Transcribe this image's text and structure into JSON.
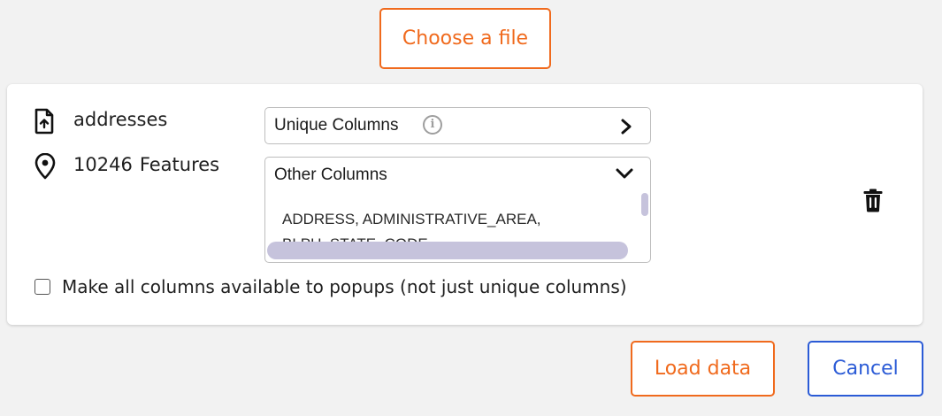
{
  "buttons": {
    "choose_file": "Choose a file",
    "load_data": "Load data",
    "cancel": "Cancel"
  },
  "file": {
    "name": "addresses",
    "feature_count": "10246",
    "feature_label": "Features",
    "icon": "file-upload-icon",
    "location_icon": "map-pin-icon"
  },
  "unique_columns": {
    "label": "Unique Columns",
    "info_icon": "info-icon",
    "state": "collapsed"
  },
  "other_columns": {
    "label": "Other Columns",
    "state": "expanded",
    "visible_text": "ADDRESS, ADMINISTRATIVE_AREA, BLPU_STATE_CODE"
  },
  "popup_option": {
    "label": "Make all columns available to popups (not just unique columns)",
    "checked": false
  },
  "colors": {
    "accent_orange": "#f06a1d",
    "accent_blue": "#2b5bd6",
    "scrollbar": "#c6c3dc"
  }
}
